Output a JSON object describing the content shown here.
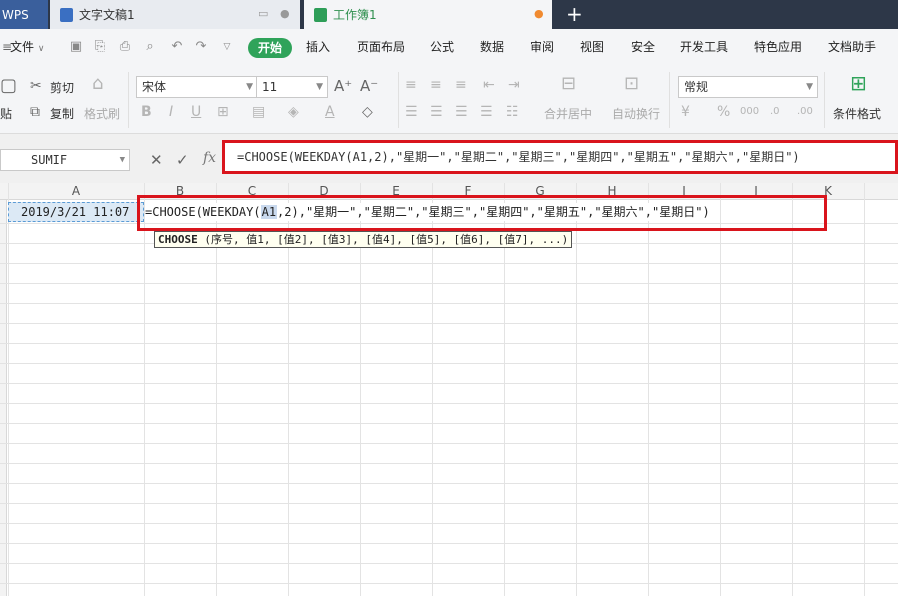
{
  "titlebar": {
    "tabs": [
      {
        "label": "WPS"
      },
      {
        "label": "文字文稿1"
      },
      {
        "label": "工作簿1"
      }
    ],
    "new_tab": "+"
  },
  "menubar": {
    "file_menu": "文件",
    "items": [
      "开始",
      "插入",
      "页面布局",
      "公式",
      "数据",
      "审阅",
      "视图",
      "安全",
      "开发工具",
      "特色应用",
      "文档助手"
    ]
  },
  "ribbon": {
    "cut": "剪切",
    "paste": "贴",
    "copy": "复制",
    "format_painter": "格式刷",
    "font_name": "宋体",
    "font_size": "11",
    "merge_center": "合并居中",
    "wrap_text": "自动换行",
    "number_format": "常规",
    "conditional_format": "条件格式"
  },
  "formula_bar": {
    "name_box": "SUMIF",
    "fx": "fx",
    "formula": "=CHOOSE(WEEKDAY(A1,2),\"星期一\",\"星期二\",\"星期三\",\"星期四\",\"星期五\",\"星期六\",\"星期日\")"
  },
  "sheet": {
    "columns": [
      "A",
      "B",
      "C",
      "D",
      "E",
      "F",
      "G",
      "H",
      "I",
      "J",
      "K"
    ],
    "cell_a1": "2019/3/21 11:07",
    "edit_prefix": "=CHOOSE(WEEKDAY(",
    "edit_ref": "A1",
    "edit_suffix": ",2),\"星期一\",\"星期二\",\"星期三\",\"星期四\",\"星期五\",\"星期六\",\"星期日\")",
    "tooltip_fn": "CHOOSE",
    "tooltip_args": " (序号, 值1, [值2], [值3], [值4], [值5], [值6], [值7], ...)"
  },
  "colors": {
    "accent_green": "#2fa35a",
    "highlight_red": "#d9141c",
    "selection_blue": "#dce9f5"
  }
}
